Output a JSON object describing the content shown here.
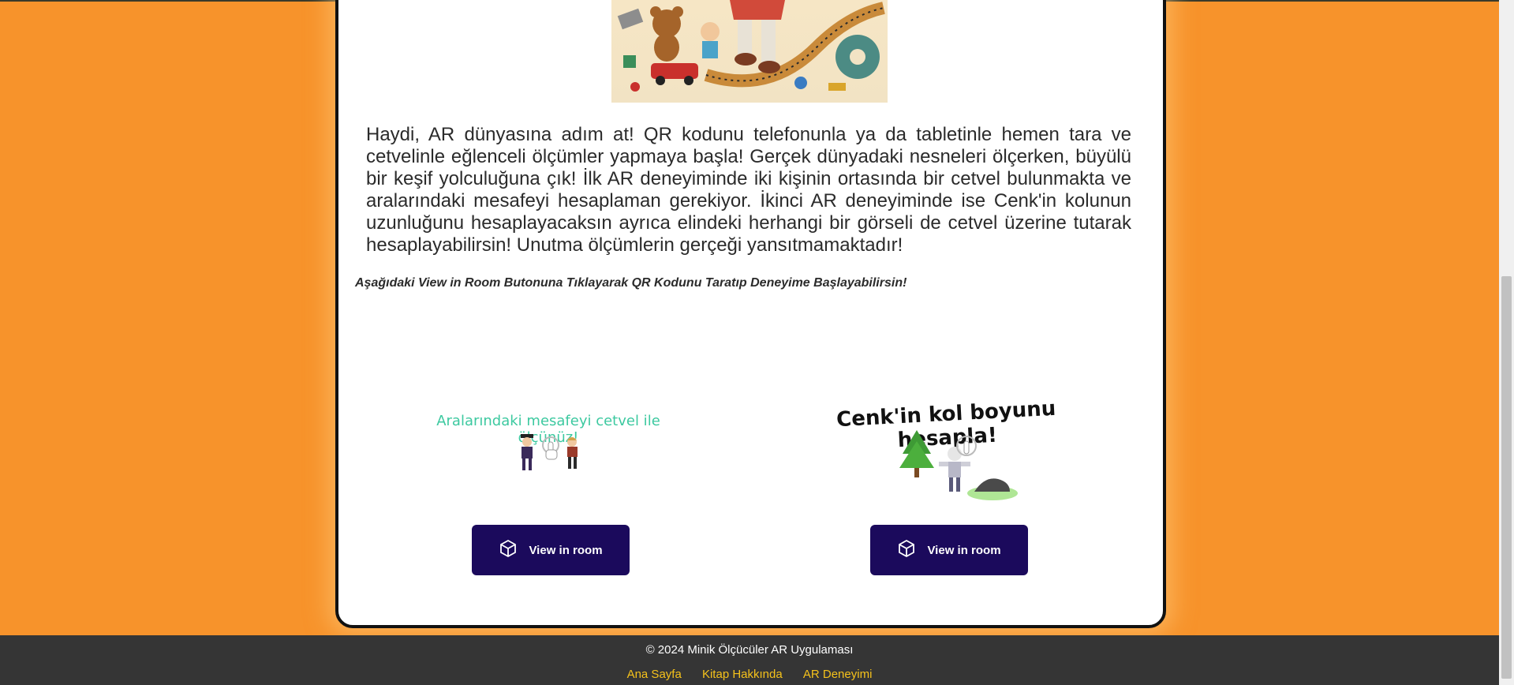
{
  "main": {
    "description": "Haydi, AR dünyasına adım at! QR kodunu telefonunla ya da tabletinle hemen tara ve cetvelinle eğlenceli ölçümler yapmaya başla! Gerçek dünyadaki nesneleri ölçerken, büyülü bir keşif yolculuğuna çık! İlk AR deneyiminde iki kişinin ortasında bir cetvel bulunmakta ve aralarındaki mesafeyi hesaplaman gerekiyor. İkinci AR deneyiminde ise Cenk'in kolunun uzunluğunu hesaplayacaksın ayrıca elindeki herhangi bir görseli de cetvel üzerine tutarak hesaplayabilirsin! Unutma ölçümlerin gerçeği yansıtmamaktadır!",
    "instruction": "Aşağıdaki View in Room Butonuna Tıklayarak QR Kodunu Taratıp Deneyime Başlayabilirsin!"
  },
  "experiences": [
    {
      "title": "Aralarındaki mesafeyi cetvel ile ölçünüz!",
      "button_label": "View in room",
      "icon": "cube-icon"
    },
    {
      "title": "Cenk'in kol boyunu hesapla!",
      "button_label": "View in room",
      "icon": "cube-icon"
    }
  ],
  "footer": {
    "copyright": "© 2024 Minik Ölçücüler AR Uygulaması",
    "links": [
      "Ana Sayfa",
      "Kitap Hakkında",
      "AR Deneyimi"
    ]
  },
  "colors": {
    "page_background": "#f7932b",
    "button_background": "#1b0a5c",
    "footer_background": "#353535",
    "footer_link": "#f5c21b",
    "experience1_title": "#3dc9a0"
  }
}
